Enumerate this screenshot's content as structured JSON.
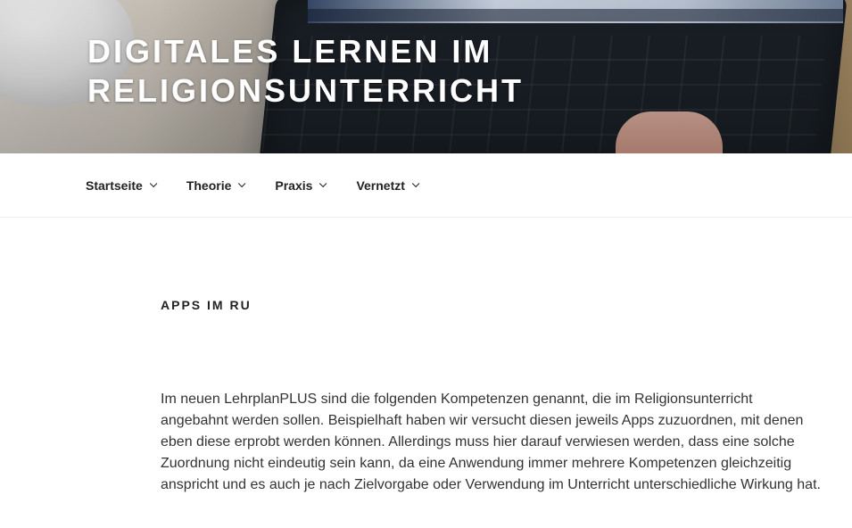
{
  "site": {
    "title_line1": "DIGITALES LERNEN IM",
    "title_line2": "RELIGIONSUNTERRICHT",
    "header_image": "laptop-keyboard-photo"
  },
  "nav": {
    "items": [
      {
        "label": "Startseite",
        "icon": "chevron-down-icon"
      },
      {
        "label": "Theorie",
        "icon": "chevron-down-icon"
      },
      {
        "label": "Praxis",
        "icon": "chevron-down-icon"
      },
      {
        "label": "Vernetzt",
        "icon": "chevron-down-icon"
      }
    ]
  },
  "page": {
    "title": "APPS IM RU",
    "paragraph": "Im neuen LehrplanPLUS sind die folgenden Kompetenzen genannt, die im Religionsunterricht angebahnt werden sollen. Beispielhaft haben wir versucht diesen jeweils Apps zuzuordnen, mit denen eben diese erprobt werden können. Allerdings muss hier darauf verwiesen werden, dass eine solche Zuordnung nicht eindeutig sein kann, da eine Anwendung immer mehrere Kompetenzen gleichzeitig anspricht und es auch je nach Zielvorgabe oder Verwendung im Unterricht unterschiedliche Wirkung hat."
  },
  "colors": {
    "text": "#333333",
    "heading": "#222222",
    "header_title": "#ffffff"
  }
}
